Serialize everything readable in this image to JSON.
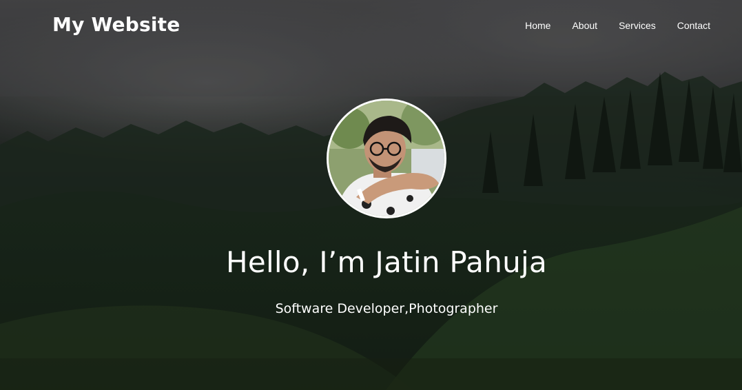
{
  "nav": {
    "brand": "My Website",
    "links": [
      {
        "label": "Home"
      },
      {
        "label": "About"
      },
      {
        "label": "Services"
      },
      {
        "label": "Contact"
      }
    ]
  },
  "hero": {
    "headline": "Hello, I’m Jatin Pahuja",
    "subtitle": "Software Developer,Photographer",
    "background": "misty forest",
    "avatar": "profile photo"
  },
  "colors": {
    "text": "#ffffff",
    "avatar_border": "#ffffff"
  }
}
